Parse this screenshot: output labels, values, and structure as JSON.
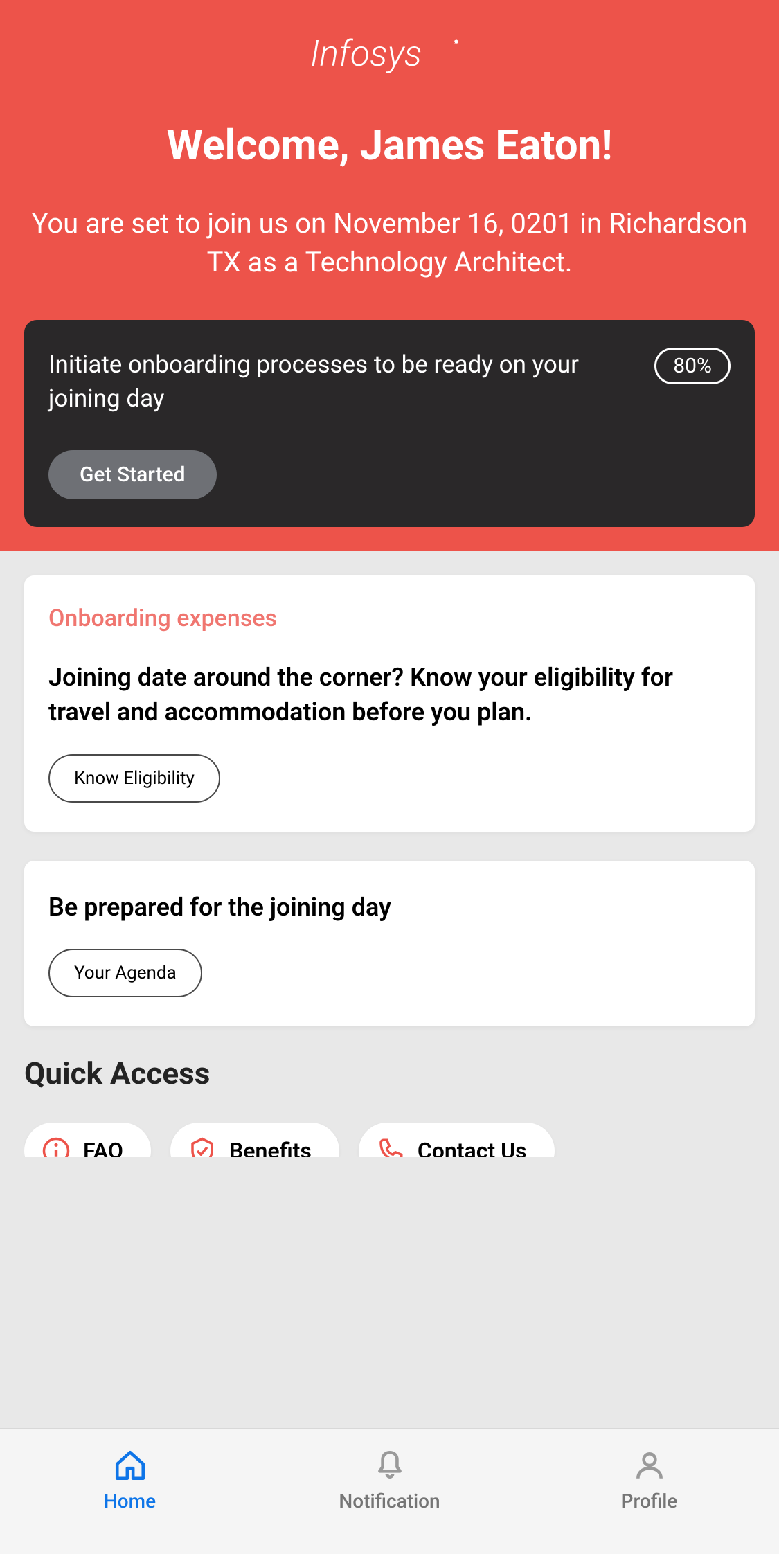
{
  "logo_text": "Infosys",
  "header": {
    "welcome_title": "Welcome, James Eaton!",
    "welcome_subtitle": "You are set to join us on November 16, 0201 in Richardson TX as a Technology Architect."
  },
  "onboarding": {
    "text": "Initiate onboarding processes to be ready on your joining day",
    "progress": "80%",
    "button": "Get Started"
  },
  "cards": {
    "expenses": {
      "label": "Onboarding expenses",
      "text": "Joining date around the corner? Know your eligibility for travel and accommodation before you plan.",
      "button": "Know Eligibility"
    },
    "agenda": {
      "text": "Be prepared for the joining day",
      "button": "Your Agenda"
    }
  },
  "quick_access": {
    "title": "Quick Access",
    "items": [
      {
        "label": "FAQ"
      },
      {
        "label": "Benefits"
      },
      {
        "label": "Contact Us"
      }
    ]
  },
  "nav": {
    "home": "Home",
    "notification": "Notification",
    "profile": "Profile"
  }
}
